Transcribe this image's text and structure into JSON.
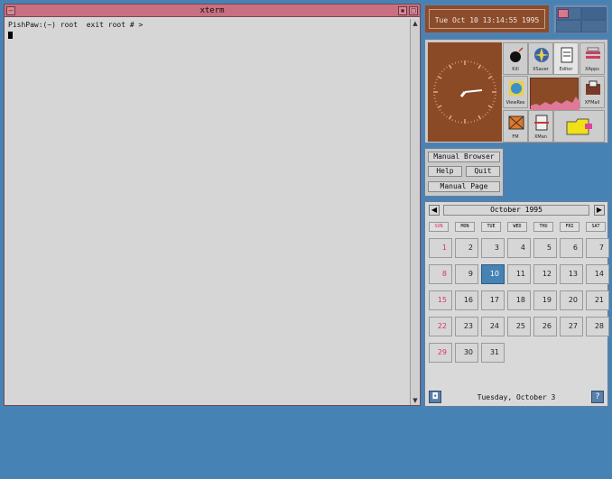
{
  "xterm": {
    "title": "xterm",
    "prompt_line": "PishPaw:(~) root  exit root # >"
  },
  "clock_text": "Tue Oct 10 13:14:55 1995",
  "tools": {
    "kill_label": "Kill",
    "xsaver_label": "XSaver",
    "editor_label": "Editor",
    "xapps_label": "XApps",
    "viewres_label": "ViewRes",
    "xfmail_label": "XFMail",
    "fm_label": "FM",
    "xman_label": "XMan"
  },
  "menu": {
    "manual_browser": "Manual Browser",
    "help": "Help",
    "quit": "Quit",
    "manual_page": "Manual Page"
  },
  "calendar": {
    "prev": "◀",
    "next": "▶",
    "month": "October 1995",
    "dow": [
      "SUN",
      "MON",
      "TUE",
      "WED",
      "THU",
      "FRI",
      "SAT"
    ],
    "weeks": [
      [
        "1",
        "2",
        "3",
        "4",
        "5",
        "6",
        "7"
      ],
      [
        "8",
        "9",
        "10",
        "11",
        "12",
        "13",
        "14"
      ],
      [
        "15",
        "16",
        "17",
        "18",
        "19",
        "20",
        "21"
      ],
      [
        "22",
        "23",
        "24",
        "25",
        "26",
        "27",
        "28"
      ],
      [
        "29",
        "30",
        "31",
        "",
        "",
        "",
        ""
      ]
    ],
    "today": "10",
    "footer_text": "Tuesday, October 3",
    "left_btn": "◘",
    "right_btn": "?"
  },
  "colors": {
    "desktop": "#4682b4",
    "titlebar": "#c8707f",
    "today": "#4682b4",
    "sunday": "#e0306a"
  }
}
